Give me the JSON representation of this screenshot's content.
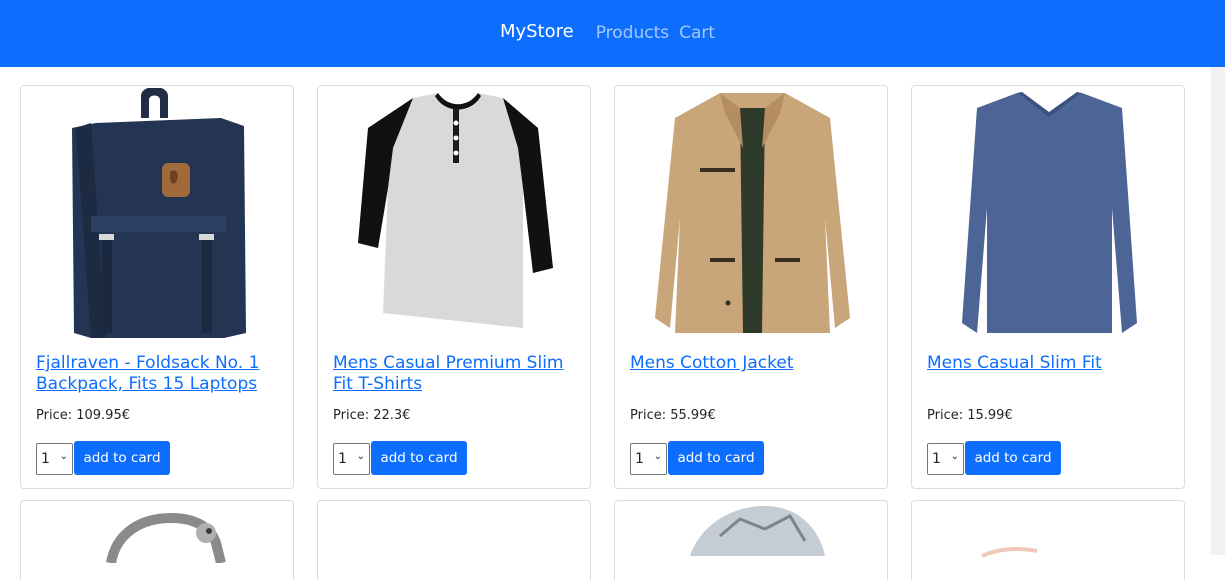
{
  "navbar": {
    "brand": "MyStore",
    "links": [
      "Products",
      "Cart"
    ]
  },
  "products": [
    {
      "title": "Fjallraven - Foldsack No. 1 Backpack, Fits 15 Laptops",
      "price_label": "Price: ",
      "price": "109.95",
      "currency": "€",
      "qty": "1",
      "button": "add to card"
    },
    {
      "title": "Mens Casual Premium Slim Fit T-Shirts",
      "price_label": "Price: ",
      "price": "22.3",
      "currency": "€",
      "qty": "1",
      "button": "add to card"
    },
    {
      "title": "Mens Cotton Jacket",
      "price_label": "Price: ",
      "price": "55.99",
      "currency": "€",
      "qty": "1",
      "button": "add to card"
    },
    {
      "title": "Mens Casual Slim Fit",
      "price_label": "Price: ",
      "price": "15.99",
      "currency": "€",
      "qty": "1",
      "button": "add to card"
    }
  ],
  "colors": {
    "navbar": "#0d6efd",
    "link": "#0d6efd",
    "button": "#0d6efd"
  },
  "icons": {
    "product_images": [
      "backpack-image",
      "tshirt-image",
      "jacket-image",
      "longsleeve-image",
      "bracelet-image",
      "blank-image",
      "ring-image",
      "jewelry-image"
    ]
  }
}
